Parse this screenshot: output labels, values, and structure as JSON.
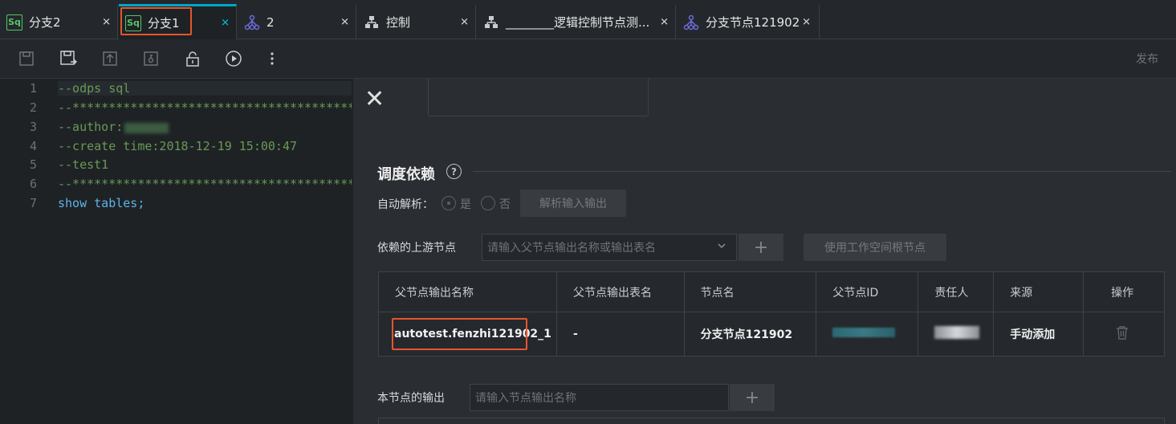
{
  "tabs": [
    {
      "label": "分支2",
      "icon": "sql-icon"
    },
    {
      "label": "分支1",
      "icon": "sql-icon",
      "active": true
    },
    {
      "label": "2",
      "icon": "branch-node-icon"
    },
    {
      "label": "控制",
      "icon": "control-node-icon"
    },
    {
      "label": "________逻辑控制节点测...",
      "icon": "control-node-icon"
    },
    {
      "label": "分支节点121902",
      "icon": "branch-node-icon"
    }
  ],
  "toolbar": {
    "icons": [
      "save-icon",
      "save-as-icon",
      "submit-icon",
      "unlock-key-icon",
      "lock-icon",
      "run-icon",
      "more-icon"
    ],
    "publish_label": "发布"
  },
  "editor": {
    "line_numbers": [
      "1",
      "2",
      "3",
      "4",
      "5",
      "6",
      "7"
    ],
    "lines": [
      "--odps sql",
      "--**********************************************",
      "--author:",
      "--create time:2018-12-19 15:00:47",
      "--test1",
      "--**********************************************",
      "show tables;"
    ]
  },
  "panel": {
    "close_glyph": "✕",
    "section_title": "调度依赖",
    "help_glyph": "?",
    "auto_parse": {
      "label": "自动解析：",
      "yes_label": "是",
      "no_label": "否",
      "button_label": "解析输入输出"
    },
    "upstream": {
      "label": "依赖的上游节点",
      "placeholder": "请输入父节点输出名称或输出表名",
      "add_glyph": "+",
      "root_button_label": "使用工作空间根节点"
    },
    "table": {
      "headers": [
        "父节点输出名称",
        "父节点输出表名",
        "节点名",
        "父节点ID",
        "责任人",
        "来源",
        "操作"
      ],
      "rows": [
        {
          "output_name": "autotest.fenzhi121902_1",
          "output_table": "-",
          "node_name": "分支节点121902",
          "node_id": "",
          "owner": "",
          "source": "手动添加"
        }
      ]
    },
    "output": {
      "label": "本节点的输出",
      "placeholder": "请输入节点输出名称",
      "add_glyph": "+"
    }
  },
  "colors": {
    "accent": "#00a6c8",
    "highlight_box": "#e5552d",
    "sql_icon": "#56c46a",
    "branch_icon": "#6b6bd8"
  }
}
